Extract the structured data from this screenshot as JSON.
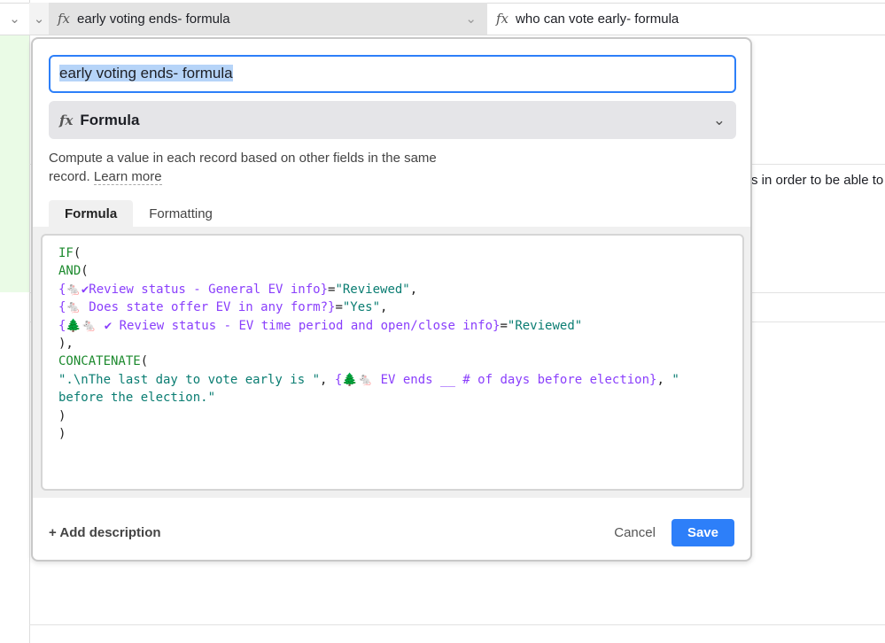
{
  "grid": {
    "columns": [
      {
        "label": "early voting ends- formula"
      },
      {
        "label": "who can vote early- formula"
      }
    ],
    "cell_fragment": "s in order to be able to"
  },
  "modal": {
    "field_name": "early voting ends- formula",
    "field_type": "Formula",
    "description": "Compute a value in each record based on other fields in the same record.",
    "learn_more": "Learn more",
    "tabs": [
      {
        "label": "Formula",
        "active": true
      },
      {
        "label": "Formatting",
        "active": false
      }
    ],
    "formula_lines": [
      [
        [
          "k",
          "IF"
        ],
        [
          "p",
          "("
        ]
      ],
      [
        [
          "k",
          "AND"
        ],
        [
          "p",
          "("
        ]
      ],
      [
        [
          "f",
          "{🐁✔Review status - General EV info}"
        ],
        [
          "p",
          "="
        ],
        [
          "s",
          "\"Reviewed\""
        ],
        [
          "p",
          ","
        ]
      ],
      [
        [
          "f",
          "{🐁 Does state offer EV in any form?}"
        ],
        [
          "p",
          "="
        ],
        [
          "s",
          "\"Yes\""
        ],
        [
          "p",
          ","
        ]
      ],
      [
        [
          "f",
          "{🌲🐁 ✔ Review status - EV time period and open/close info}"
        ],
        [
          "p",
          "="
        ],
        [
          "s",
          "\"Reviewed\""
        ]
      ],
      [
        [
          "p",
          "),"
        ]
      ],
      [
        [
          "k",
          "CONCATENATE"
        ],
        [
          "p",
          "("
        ]
      ],
      [
        [
          "s",
          "\".\\nThe last day to vote early is \""
        ],
        [
          "p",
          ", "
        ],
        [
          "f",
          "{🌲🐁 EV ends __ # of days before election}"
        ],
        [
          "p",
          ", "
        ],
        [
          "s",
          "\" before the election.\""
        ]
      ],
      [
        [
          "p",
          ")"
        ]
      ],
      [
        [
          "p",
          ")"
        ]
      ]
    ],
    "add_description": "Add description",
    "cancel": "Cancel",
    "save": "Save"
  },
  "colors": {
    "accent": "#2d7ff9",
    "function": "#1d8a2e",
    "field": "#8a3ffc",
    "string": "#0a7d72"
  }
}
